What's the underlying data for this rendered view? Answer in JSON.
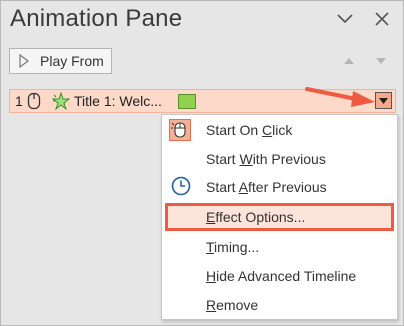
{
  "pane": {
    "title": "Animation Pane",
    "play_from_label": "Play From"
  },
  "animation_row": {
    "order": "1",
    "label": "Title 1: Welc..."
  },
  "menu": {
    "items": [
      {
        "pre": "Start On ",
        "key": "C",
        "post": "lick",
        "icon": "mouse-click-icon"
      },
      {
        "pre": "Start ",
        "key": "W",
        "post": "ith Previous",
        "icon": null
      },
      {
        "pre": "Start ",
        "key": "A",
        "post": "fter Previous",
        "icon": "clock-icon"
      },
      {
        "pre": "",
        "key": "E",
        "post": "ffect Options...",
        "icon": null
      },
      {
        "pre": "",
        "key": "T",
        "post": "iming...",
        "icon": null
      },
      {
        "pre": "",
        "key": "H",
        "post": "ide Advanced Timeline",
        "icon": null
      },
      {
        "pre": "",
        "key": "R",
        "post": "emove",
        "icon": null
      }
    ]
  },
  "colors": {
    "accent": "#ef5a43",
    "row_highlight": "#fcd9c8",
    "timeline_bar": "#92d050"
  }
}
